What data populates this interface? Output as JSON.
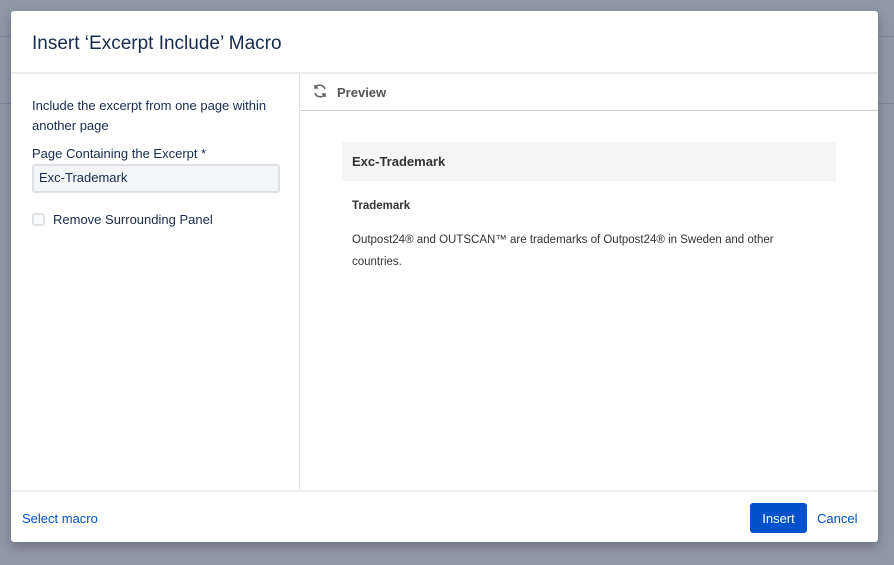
{
  "dialog": {
    "title": "Insert ‘Excerpt Include’ Macro"
  },
  "form": {
    "description": "Include the excerpt from one page within another page",
    "page_label": "Page Containing the Excerpt *",
    "page_value": "Exc-Trademark",
    "remove_panel_label": "Remove Surrounding Panel",
    "remove_panel_checked": false
  },
  "preview": {
    "header": "Preview",
    "panel_title": "Exc-Trademark",
    "heading": "Trademark",
    "body": "Outpost24® and OUTSCAN™ are trademarks of Outpost24® in Sweden and other countries."
  },
  "footer": {
    "select_macro": "Select macro",
    "insert": "Insert",
    "cancel": "Cancel"
  },
  "colors": {
    "accent": "#0052cc"
  }
}
